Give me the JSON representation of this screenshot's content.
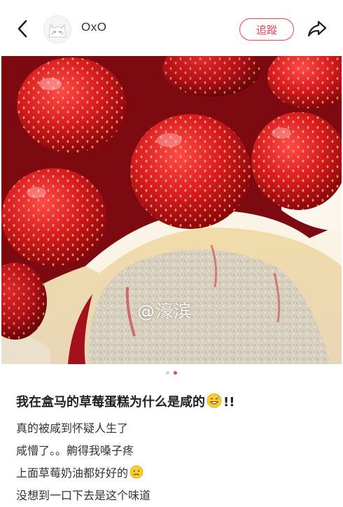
{
  "header": {
    "username": "OxO",
    "follow_label": "追蹤",
    "back_icon": "chevron-left-icon",
    "share_icon": "share-arrow-icon"
  },
  "photo": {
    "watermark": "@濠滨"
  },
  "pagination": {
    "total": 2,
    "active_index": 1
  },
  "post": {
    "title_text": "我在盒马的草莓蛋糕为什么是咸的",
    "title_emoji": "grinning-sweat-emoji",
    "title_suffix": "!!",
    "lines": [
      "真的被咸到怀疑人生了",
      "咸懵了。。齁得我嗓子疼",
      "上面草莓奶油都好好的",
      "没想到一口下去是这个味道"
    ],
    "line3_emoji": "crying-face-emoji"
  },
  "colors": {
    "accent": "#e8455a",
    "text": "#222222",
    "dot_inactive": "#d4d4d4"
  }
}
